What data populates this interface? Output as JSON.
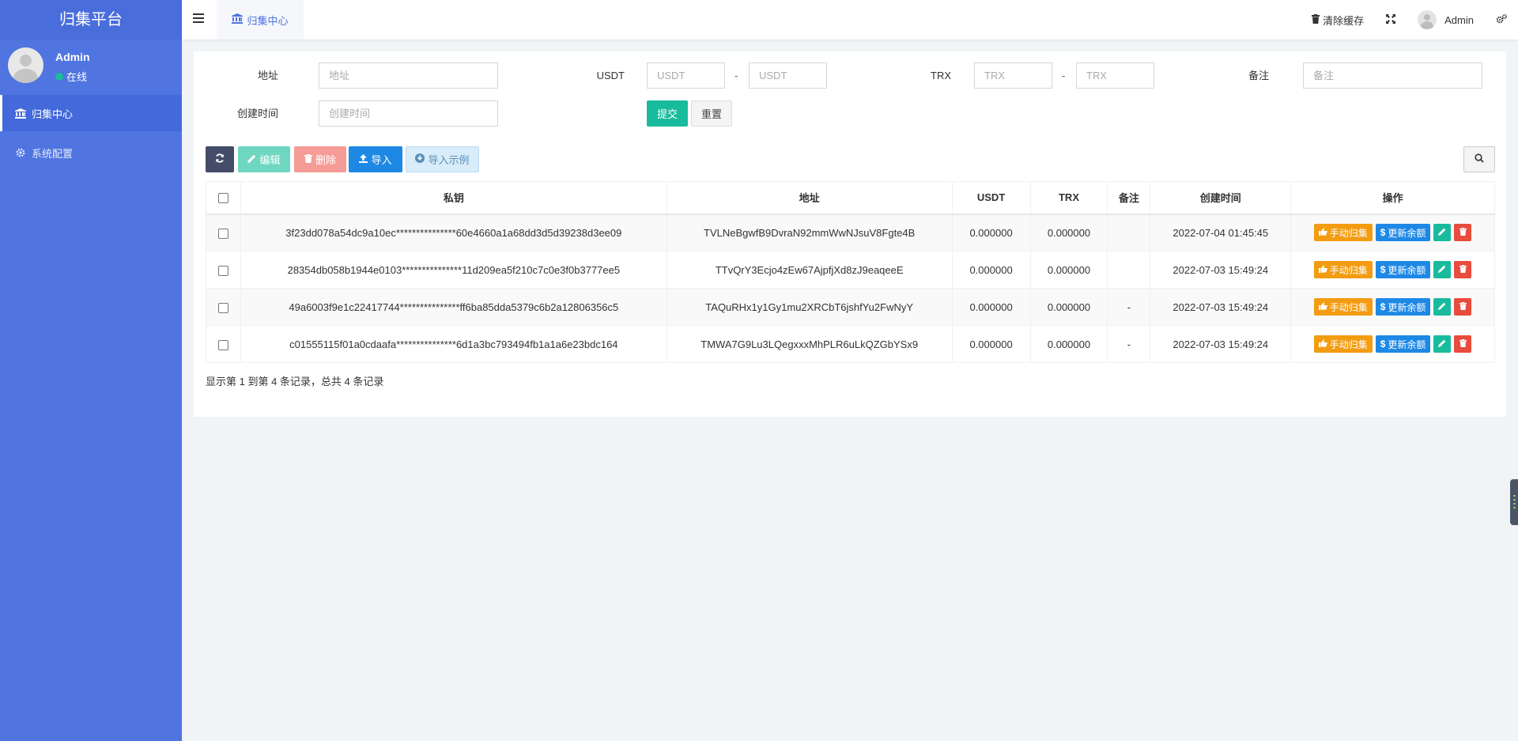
{
  "brand": "归集平台",
  "user": {
    "name": "Admin",
    "status": "在线"
  },
  "sidebar": {
    "items": [
      {
        "label": "归集中心",
        "icon": "bank-icon",
        "active": true
      },
      {
        "label": "系统配置",
        "icon": "gear-icon",
        "active": false
      }
    ]
  },
  "topbar": {
    "active_tab": "归集中心",
    "clear_cache": "清除缓存",
    "admin": "Admin"
  },
  "filters": {
    "address_label": "地址",
    "address_placeholder": "地址",
    "usdt_label": "USDT",
    "usdt_min_placeholder": "USDT",
    "usdt_max_placeholder": "USDT",
    "trx_label": "TRX",
    "trx_min_placeholder": "TRX",
    "trx_max_placeholder": "TRX",
    "remark_label": "备注",
    "remark_placeholder": "备注",
    "created_label": "创建时间",
    "created_placeholder": "创建时间",
    "range_sep": "-",
    "submit": "提交",
    "reset": "重置"
  },
  "toolbar": {
    "edit": "编辑",
    "delete": "删除",
    "import": "导入",
    "example": "导入示例"
  },
  "table": {
    "headers": [
      "私钥",
      "地址",
      "USDT",
      "TRX",
      "备注",
      "创建时间",
      "操作"
    ],
    "rows": [
      {
        "key": "3f23dd078a54dc9a10ec***************60e4660a1a68dd3d5d39238d3ee09",
        "address": "TVLNeBgwfB9DvraN92mmWwNJsuV8Fgte4B",
        "usdt": "0.000000",
        "trx": "0.000000",
        "remark": "",
        "created": "2022-07-04 01:45:45"
      },
      {
        "key": "28354db058b1944e0103***************11d209ea5f210c7c0e3f0b3777ee5",
        "address": "TTvQrY3Ecjo4zEw67AjpfjXd8zJ9eaqeeE",
        "usdt": "0.000000",
        "trx": "0.000000",
        "remark": "",
        "created": "2022-07-03 15:49:24"
      },
      {
        "key": "49a6003f9e1c22417744***************ff6ba85dda5379c6b2a12806356c5",
        "address": "TAQuRHx1y1Gy1mu2XRCbT6jshfYu2FwNyY",
        "usdt": "0.000000",
        "trx": "0.000000",
        "remark": "-",
        "created": "2022-07-03 15:49:24"
      },
      {
        "key": "c01555115f01a0cdaafa***************6d1a3bc793494fb1a1a6e23bdc164",
        "address": "TMWA7G9Lu3LQegxxxMhPLR6uLkQZGbYSx9",
        "usdt": "0.000000",
        "trx": "0.000000",
        "remark": "-",
        "created": "2022-07-03 15:49:24"
      }
    ],
    "op_collect": "手动归集",
    "op_refresh": "更新余额"
  },
  "pager": "显示第 1 到第 4 条记录，总共 4 条记录"
}
